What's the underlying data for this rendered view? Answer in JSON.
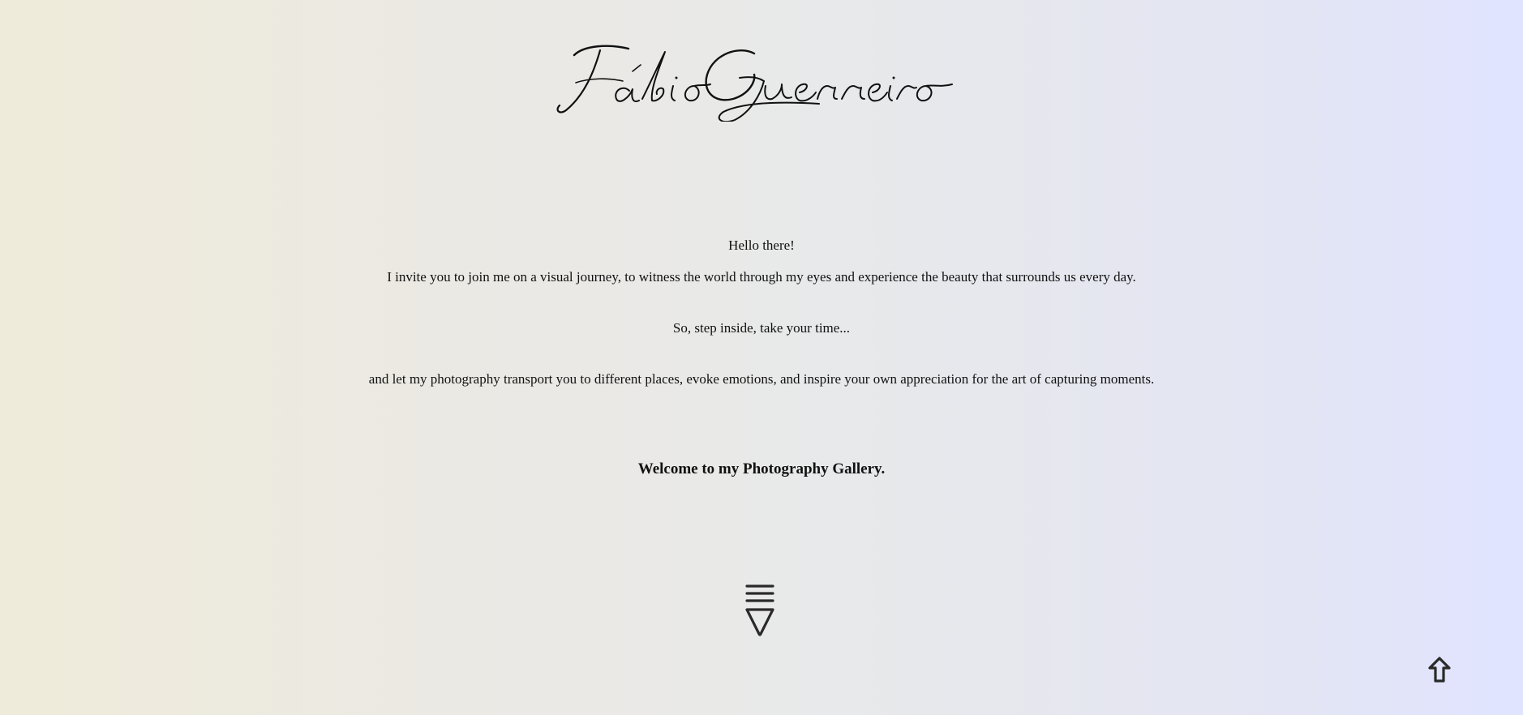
{
  "header": {
    "signature_text": "Fábio Guerreiro"
  },
  "intro": {
    "greeting": "Hello there!",
    "invite": "I invite you to join me on a visual journey, to witness the world through my eyes and experience the beauty that surrounds us every day.",
    "step_inside": "So, step inside, take your time...",
    "transport": "and let my photography transport you to different places, evoke emotions, and inspire your own appreciation for the art of capturing moments."
  },
  "welcome": "Welcome to my Photography Gallery.",
  "icons": {
    "scroll_down": "scroll-down-icon",
    "back_to_top": "arrow-up-icon"
  },
  "colors": {
    "background_left": "#efebda",
    "background_right": "#e0e4ff",
    "text": "#111111",
    "icon": "#2a2a2a"
  }
}
